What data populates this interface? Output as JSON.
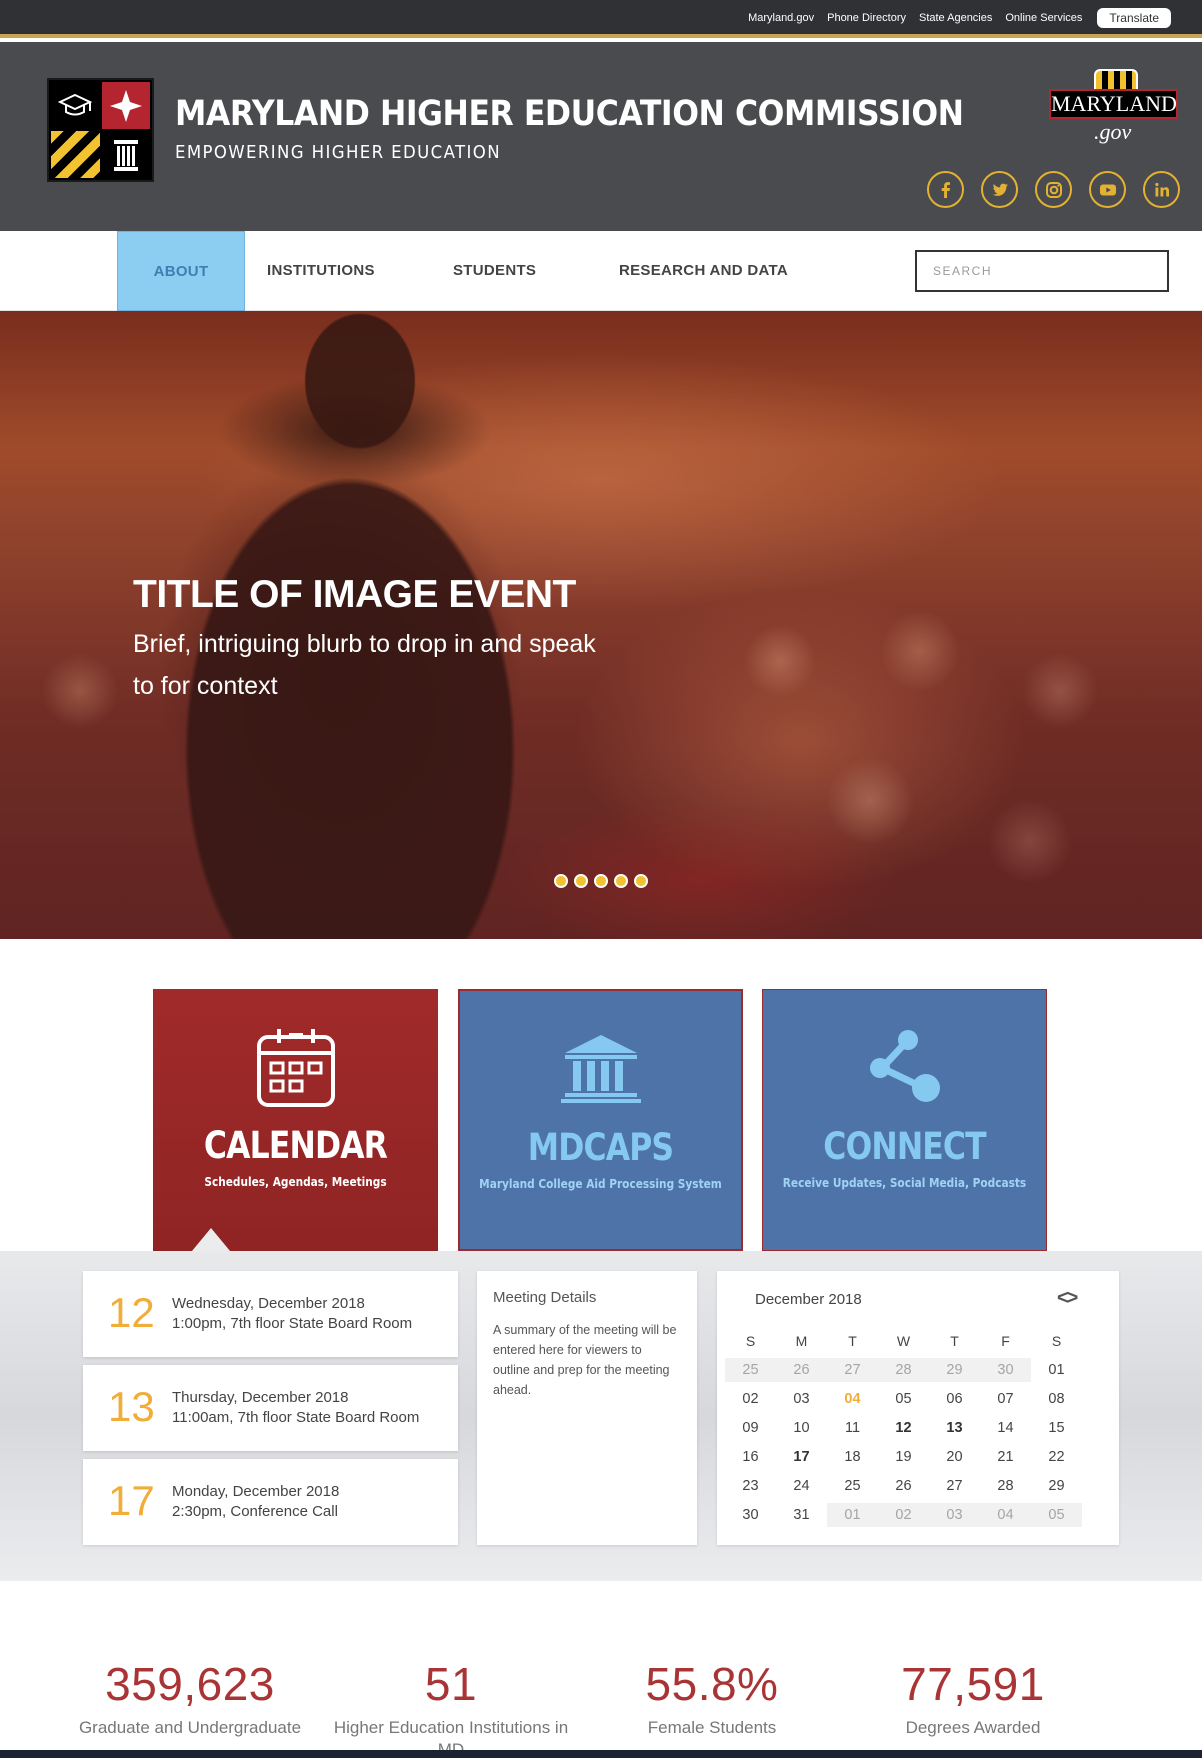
{
  "utility": {
    "links": [
      "Maryland.gov",
      "Phone Directory",
      "State Agencies",
      "Online Services"
    ],
    "translate_label": "Translate"
  },
  "header": {
    "title": "MARYLAND HIGHER EDUCATION COMMISSION",
    "tagline": "EMPOWERING HIGHER EDUCATION",
    "mdgov_word": "MARYLAND",
    "mdgov_suffix": ".gov",
    "socials": [
      "facebook-icon",
      "twitter-icon",
      "instagram-icon",
      "youtube-icon",
      "linkedin-icon"
    ]
  },
  "nav": {
    "items": [
      "ABOUT",
      "INSTITUTIONS",
      "STUDENTS",
      "RESEARCH AND DATA"
    ],
    "active": "ABOUT",
    "search_placeholder": "SEARCH"
  },
  "hero": {
    "title": "TITLE OF IMAGE EVENT",
    "blurb": "Brief, intriguing blurb to drop in and speak to for context",
    "slide_count": 5
  },
  "cards": [
    {
      "title": "CALENDAR",
      "subtitle": "Schedules, Agendas, Meetings",
      "icon": "calendar-icon"
    },
    {
      "title": "MDCAPS",
      "subtitle": "Maryland College Aid Processing System",
      "icon": "institution-icon"
    },
    {
      "title": "CONNECT",
      "subtitle": "Receive Updates, Social Media, Podcasts",
      "icon": "share-icon"
    }
  ],
  "events": [
    {
      "day": "12",
      "date": "Wednesday, December 2018",
      "info": "1:00pm, 7th floor State Board Room"
    },
    {
      "day": "13",
      "date": "Thursday, December 2018",
      "info": "11:00am, 7th floor State Board Room"
    },
    {
      "day": "17",
      "date": "Monday, December 2018",
      "info": "2:30pm, Conference Call"
    }
  ],
  "meeting": {
    "title": "Meeting Details",
    "text": "A summary of the meeting will be entered here for viewers to outline and prep for the meeting ahead."
  },
  "calendar": {
    "month": "December 2018",
    "arrows": "<>",
    "weekdays": [
      "S",
      "M",
      "T",
      "W",
      "T",
      "F",
      "S"
    ],
    "weeks": [
      [
        "25",
        "26",
        "27",
        "28",
        "29",
        "30",
        "01"
      ],
      [
        "02",
        "03",
        "04",
        "05",
        "06",
        "07",
        "08"
      ],
      [
        "09",
        "10",
        "11",
        "12",
        "13",
        "14",
        "15"
      ],
      [
        "16",
        "17",
        "18",
        "19",
        "20",
        "21",
        "22"
      ],
      [
        "23",
        "24",
        "25",
        "26",
        "27",
        "28",
        "29"
      ],
      [
        "30",
        "31",
        "01",
        "02",
        "03",
        "04",
        "05"
      ]
    ],
    "today": "04",
    "event_days": [
      "12",
      "13",
      "17"
    ]
  },
  "stats": [
    {
      "value": "359,623",
      "label": "Graduate and Undergraduate"
    },
    {
      "value": "51",
      "label": "Higher Education Institutions in MD"
    },
    {
      "value": "55.8%",
      "label": "Female Students"
    },
    {
      "value": "77,591",
      "label": "Degrees Awarded"
    }
  ],
  "colors": {
    "accent_gold": "#f0ad3a",
    "brand_red": "#a12a2a",
    "brand_blue": "#4e73a8",
    "active_nav": "#8ccef2"
  }
}
